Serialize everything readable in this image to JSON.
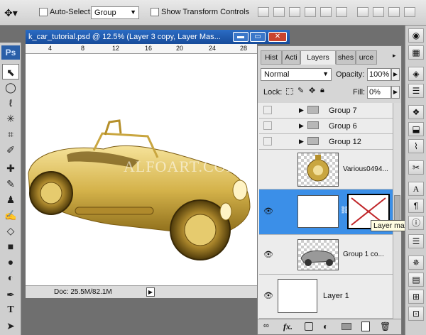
{
  "options_bar": {
    "auto_select_label": "Auto-Select:",
    "auto_select_value": "Group",
    "transform_label": "Show Transform Controls"
  },
  "toolbox": {
    "logo": "Ps",
    "tools": [
      "move-icon",
      "marquee-icon",
      "lasso-icon",
      "magic-wand-icon",
      "crop-icon",
      "eyedropper-icon",
      "healing-icon",
      "brush-icon",
      "clone-stamp-icon",
      "history-brush-icon",
      "eraser-icon",
      "gradient-icon",
      "blur-icon",
      "dodge-icon",
      "pen-icon",
      "type-icon",
      "path-select-icon"
    ]
  },
  "document": {
    "title": "k_car_tutorial.psd @ 12.5% (Layer 3 copy, Layer Mas...",
    "ruler_ticks": [
      "4",
      "8",
      "12",
      "16",
      "20",
      "24",
      "28"
    ],
    "watermark": "ALFOART.COM",
    "status": "Doc: 25.5M/82.1M"
  },
  "layers_panel": {
    "tabs": [
      "Hist",
      "Acti",
      "Layers",
      "shes",
      "urce"
    ],
    "blend_mode": "Normal",
    "opacity_label": "Opacity:",
    "opacity_value": "100%",
    "lock_label": "Lock:",
    "fill_label": "Fill:",
    "fill_value": "0%",
    "groups": [
      "Group 7",
      "Group 6",
      "Group 12"
    ],
    "layer_various": "Various0494...",
    "layer_group1": "Group 1 co...",
    "layer_1": "Layer 1",
    "tooltip": "Layer mask thu",
    "accent": "#3b8fe8"
  }
}
